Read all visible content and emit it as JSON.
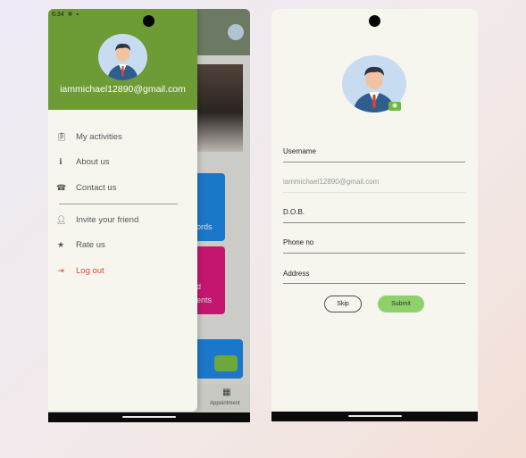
{
  "left_screen": {
    "status_time": "6:34",
    "drawer": {
      "email": "iammichael12890@gmail.com",
      "items": [
        {
          "label": "My activities",
          "icon": "clipboard-icon"
        },
        {
          "label": "About us",
          "icon": "info-icon"
        },
        {
          "label": "Contact us",
          "icon": "phone-icon"
        },
        {
          "label": "Invite your friend",
          "icon": "person-add-icon"
        },
        {
          "label": "Rate us",
          "icon": "star-icon"
        },
        {
          "label": "Log out",
          "icon": "logout-icon"
        }
      ]
    },
    "background_app": {
      "card1_text": "ords",
      "card2_line1": "d",
      "card2_line2": "ents",
      "nav_label": "Appointment"
    }
  },
  "right_screen": {
    "form": {
      "username_label": "Username",
      "email_value": "iammichael12890@gmail.com",
      "dob_label": "D.O.B.",
      "phone_label": "Phone no",
      "address_label": "Address",
      "skip_label": "Skip",
      "submit_label": "Submit"
    }
  },
  "colors": {
    "header_green": "#6d9b35",
    "submit_green": "#8ed16a",
    "logout_red": "#e24a3b",
    "card_blue": "#1e88e5",
    "card_pink": "#e0197f"
  }
}
